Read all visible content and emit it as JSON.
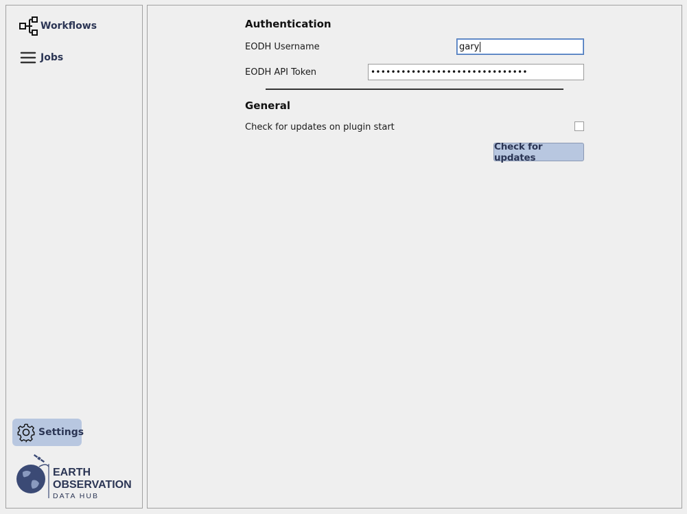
{
  "sidebar": {
    "items": [
      {
        "label": "Workflows",
        "icon": "workflow-icon"
      },
      {
        "label": "Jobs",
        "icon": "hamburger-menu-icon"
      },
      {
        "label": "Settings",
        "icon": "gear-icon"
      }
    ],
    "logo": {
      "line1": "EARTH",
      "line2": "OBSERVATION",
      "line3": "DATA HUB"
    }
  },
  "settings": {
    "authentication": {
      "title": "Authentication",
      "username_label": "EODH Username",
      "username_value": "gary",
      "token_label": "EODH API Token",
      "token_value": "•••••••••••••••••••••••••••••••"
    },
    "general": {
      "title": "General",
      "check_updates_label": "Check for updates on plugin start",
      "check_updates_checked": false,
      "check_updates_button": "Check for updates"
    }
  },
  "colors": {
    "accent": "#b8c7e0",
    "nav_text": "#2b3554",
    "background": "#efefef"
  }
}
